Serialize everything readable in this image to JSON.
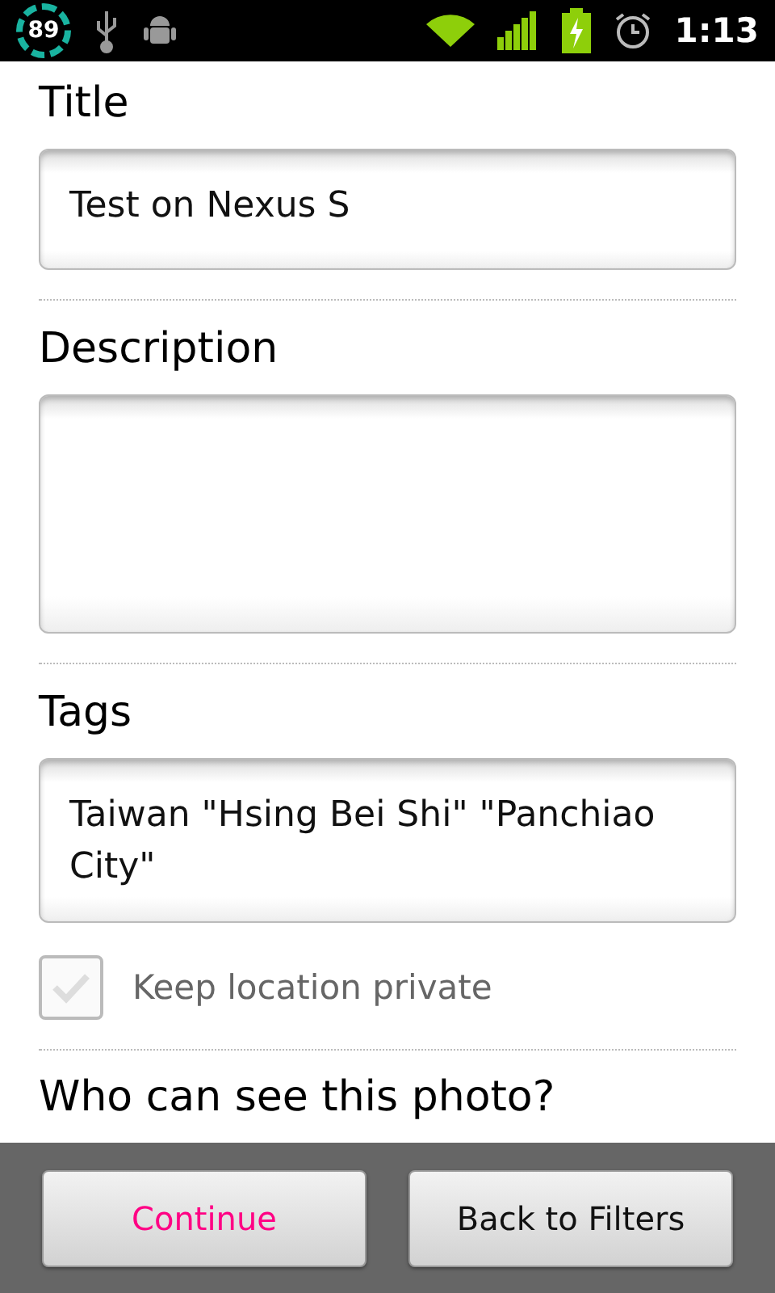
{
  "status_bar": {
    "battery_percent": "89",
    "time": "1:13"
  },
  "fields": [
    {
      "label": "Title",
      "value": "Test on Nexus S",
      "kind": "single"
    },
    {
      "label": "Description",
      "kind": "area"
    },
    {
      "label": "Tags",
      "value": "Taiwan \"Hsing Bei Shi\" \"Panchiao City\"",
      "kind": "multi"
    }
  ],
  "keep_location_private": {
    "label": "Keep location private",
    "checked": false
  },
  "visibility": {
    "heading": "Who can see this photo?"
  },
  "buttons": [
    {
      "label": "Continue",
      "kind": "primary"
    },
    {
      "label": "Back to Filters",
      "kind": "secondary"
    }
  ]
}
